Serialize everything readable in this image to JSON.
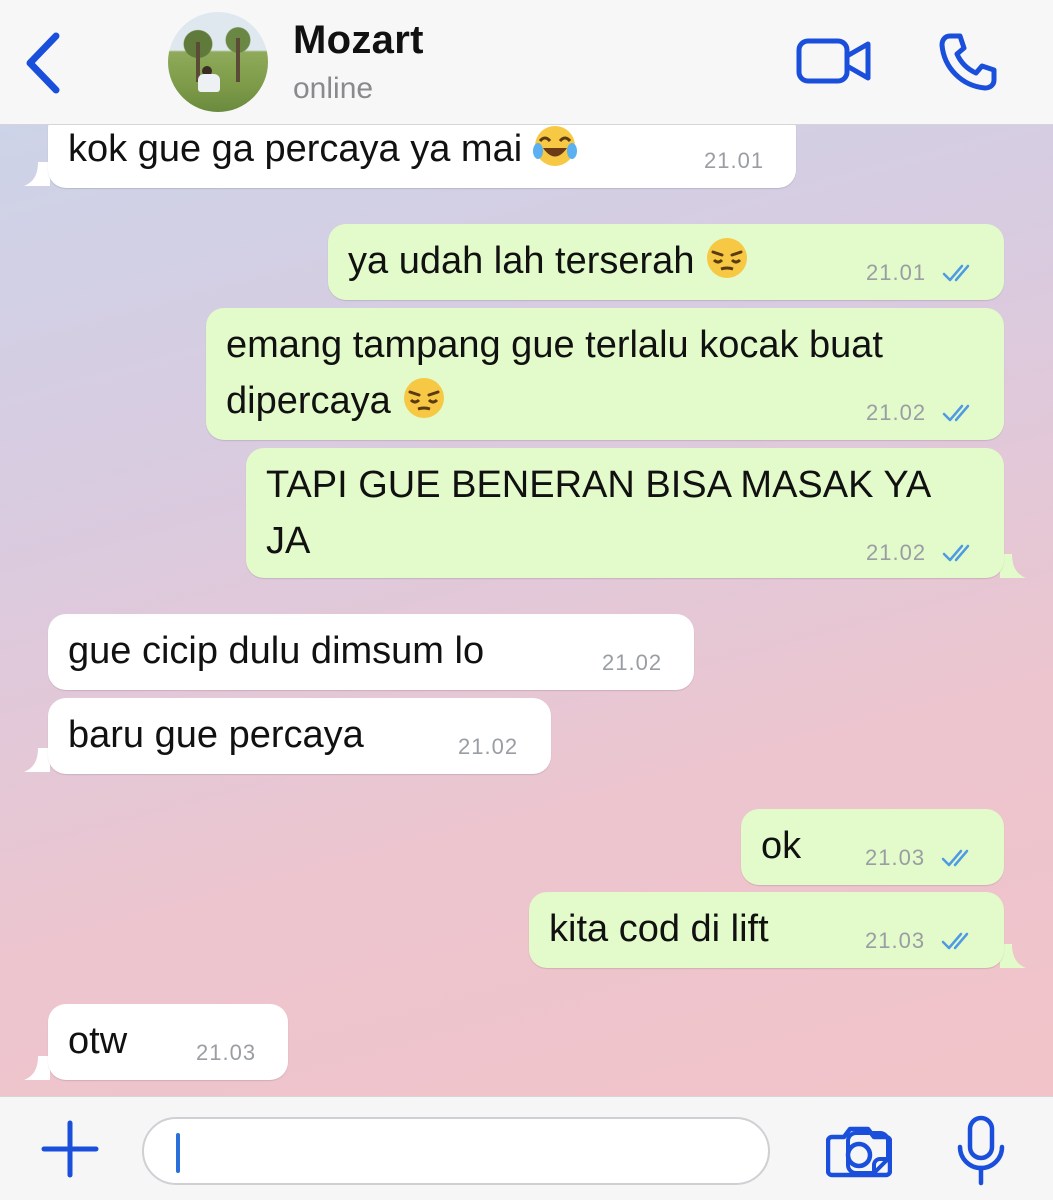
{
  "colors": {
    "accent": "#1a4fdc",
    "incoming_bubble": "#ffffff",
    "outgoing_bubble": "#e3fbcb",
    "read_check": "#4f9be3",
    "timestamp": "#9a9ea3"
  },
  "header": {
    "contact_name": "Mozart",
    "contact_status": "online",
    "back_icon": "chevron-left-icon",
    "video_icon": "video-camera-icon",
    "call_icon": "phone-icon"
  },
  "messages": [
    {
      "direction": "in",
      "text": "kok gue ga percaya ya mai",
      "emoji": "tears-of-joy",
      "time": "21.01"
    },
    {
      "direction": "out",
      "text": "ya udah lah terserah",
      "emoji": "pensive",
      "time": "21.01",
      "read": true
    },
    {
      "direction": "out",
      "text_line1": "emang tampang gue terlalu kocak buat",
      "text_line2": "dipercaya",
      "emoji": "pensive",
      "time": "21.02",
      "read": true
    },
    {
      "direction": "out",
      "text_line1": "TAPI GUE BENERAN BISA MASAK YA",
      "text_line2": "JA",
      "time": "21.02",
      "read": true
    },
    {
      "direction": "in",
      "text": "gue cicip dulu dimsum lo",
      "time": "21.02"
    },
    {
      "direction": "in",
      "text": "baru gue percaya",
      "time": "21.02"
    },
    {
      "direction": "out",
      "text": "ok",
      "time": "21.03",
      "read": true
    },
    {
      "direction": "out",
      "text": "kita cod di lift",
      "time": "21.03",
      "read": true
    },
    {
      "direction": "in",
      "text": "otw",
      "time": "21.03"
    }
  ],
  "input_bar": {
    "message_value": "",
    "plus_icon": "plus-icon",
    "sticker_icon": "sticker-icon",
    "camera_icon": "camera-icon",
    "mic_icon": "microphone-icon"
  }
}
